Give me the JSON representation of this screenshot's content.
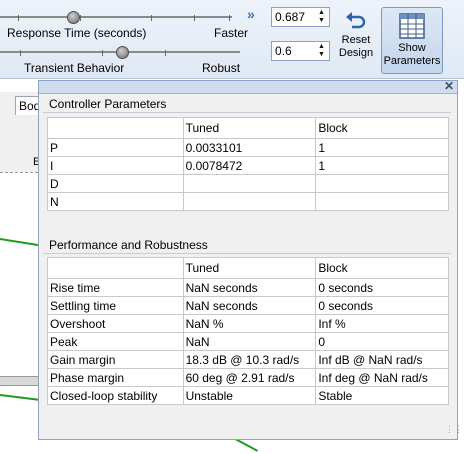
{
  "toolbar": {
    "response_time_label": "Response Time (seconds)",
    "faster_label": "Faster",
    "transient_label": "Transient Behavior",
    "robust_label": "Robust",
    "response_time_value": "0.687",
    "transient_value": "0.6",
    "reset_design_label_line1": "Reset",
    "reset_design_label_line2": "Design",
    "show_parameters_label_line1": "Show",
    "show_parameters_label_line2": "Parameters"
  },
  "background": {
    "tab_label": "Bod",
    "axis_fragment": "E"
  },
  "controller_parameters": {
    "title": "Controller Parameters",
    "columns": [
      "",
      "Tuned",
      "Block"
    ],
    "rows": [
      [
        "P",
        "0.0033101",
        "1"
      ],
      [
        "I",
        "0.0078472",
        "1"
      ],
      [
        "D",
        "",
        ""
      ],
      [
        "N",
        "",
        ""
      ]
    ]
  },
  "performance": {
    "title": "Performance and Robustness",
    "columns": [
      "",
      "Tuned",
      "Block"
    ],
    "rows": [
      [
        "Rise time",
        "NaN seconds",
        "0 seconds"
      ],
      [
        "Settling time",
        "NaN seconds",
        "0 seconds"
      ],
      [
        "Overshoot",
        "NaN %",
        "Inf %"
      ],
      [
        "Peak",
        "NaN",
        "0"
      ],
      [
        "Gain margin",
        "18.3 dB @ 10.3 rad/s",
        "Inf dB @ NaN rad/s"
      ],
      [
        "Phase margin",
        "60 deg @ 2.91 rad/s",
        "Inf deg @ NaN rad/s"
      ],
      [
        "Closed-loop stability",
        "Unstable",
        "Stable"
      ]
    ]
  },
  "colors": {
    "plot_line": "#1f9a1f",
    "accent": "#3a6fb5"
  }
}
